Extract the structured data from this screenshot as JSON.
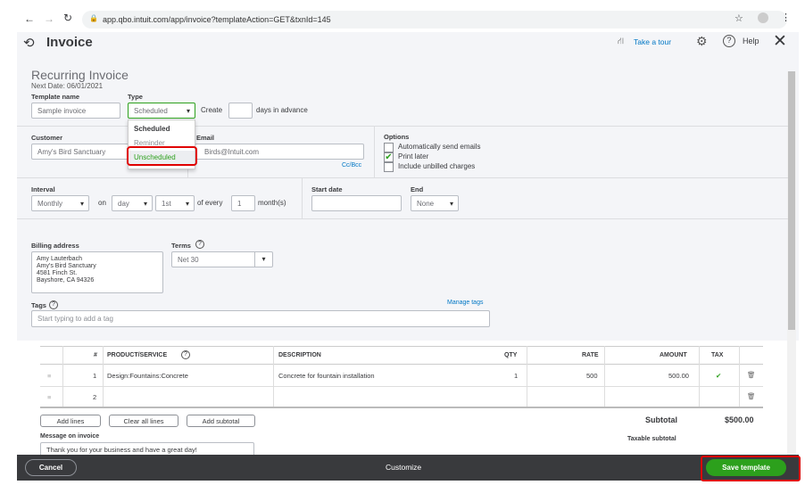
{
  "browser": {
    "url": "app.qbo.intuit.com/app/invoice?templateAction=GET&txnId=145"
  },
  "header": {
    "title": "Invoice",
    "take_tour": "Take a tour",
    "help": "Help"
  },
  "form": {
    "heading": "Recurring Invoice",
    "next_date": "Next Date: 06/01/2021",
    "template_name_label": "Template name",
    "template_name_value": "Sample invoice",
    "type_label": "Type",
    "type_value": "Scheduled",
    "type_options": [
      "Scheduled",
      "Reminder",
      "Unscheduled"
    ],
    "create_label": "Create",
    "create_value": "",
    "days_label": "days in advance",
    "customer_label": "Customer",
    "customer_value": "Amy's Bird Sanctuary",
    "email_label": "Email",
    "email_value": "Birds@Intuit.com",
    "ccbcc": "Cc/Bcc",
    "options_label": "Options",
    "options": [
      {
        "label": "Automatically send emails",
        "checked": false
      },
      {
        "label": "Print later",
        "checked": true
      },
      {
        "label": "Include unbilled charges",
        "checked": false
      }
    ],
    "interval_label": "Interval",
    "interval_value": "Monthly",
    "on_label": "on",
    "day_value": "day",
    "nth_value": "1st",
    "every_label": "of every",
    "every_value": "1",
    "months_label": "month(s)",
    "start_date_label": "Start date",
    "start_date_value": "",
    "end_label": "End",
    "end_value": "None",
    "billing_label": "Billing address",
    "billing_lines": [
      "Amy Lauterbach",
      "Amy's Bird Sanctuary",
      "4581 Finch St.",
      "Bayshore, CA  94326"
    ],
    "terms_label": "Terms",
    "terms_value": "Net 30",
    "tags_label": "Tags",
    "manage_tags": "Manage tags",
    "tags_placeholder": "Start typing to add a tag"
  },
  "table": {
    "headers": [
      "#",
      "PRODUCT/SERVICE",
      "DESCRIPTION",
      "QTY",
      "RATE",
      "AMOUNT",
      "TAX"
    ],
    "rows": [
      {
        "num": "1",
        "product": "Design:Fountains:Concrete",
        "description": "Concrete for fountain installation",
        "qty": "1",
        "rate": "500",
        "amount": "500.00",
        "tax": "✔"
      },
      {
        "num": "2",
        "product": "",
        "description": "",
        "qty": "",
        "rate": "",
        "amount": "",
        "tax": ""
      }
    ],
    "add_lines": "Add lines",
    "clear_lines": "Clear all lines",
    "add_subtotal": "Add subtotal",
    "subtotal_label": "Subtotal",
    "subtotal_value": "$500.00",
    "taxable_subtotal": "Taxable subtotal",
    "message_label": "Message on invoice",
    "message_value": "Thank you for your business and have a great day!"
  },
  "footer": {
    "cancel": "Cancel",
    "customize": "Customize",
    "save": "Save template"
  },
  "colors": {
    "green": "#2ca01c",
    "highlight": "#e00000",
    "footer": "#393a3d"
  }
}
